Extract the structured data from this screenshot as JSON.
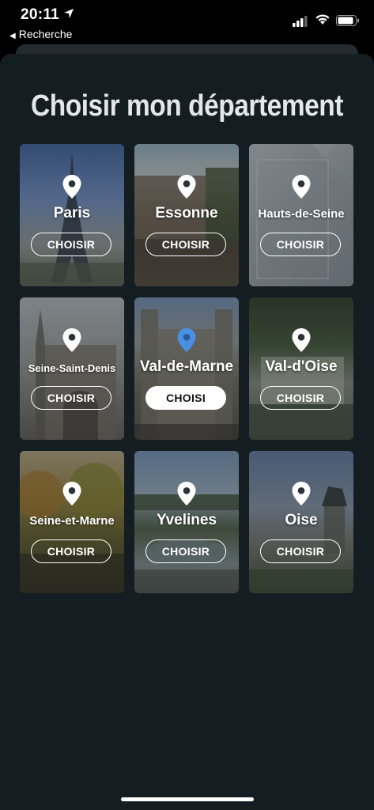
{
  "status": {
    "time": "20:11",
    "back_label": "Recherche"
  },
  "title": "Choisir mon département",
  "departments": [
    {
      "name": "Paris",
      "button": "CHOISIR",
      "selected": false
    },
    {
      "name": "Essonne",
      "button": "CHOISIR",
      "selected": false
    },
    {
      "name": "Hauts-de-Seine",
      "button": "CHOISIR",
      "selected": false
    },
    {
      "name": "Seine-Saint-Denis",
      "button": "CHOISIR",
      "selected": false
    },
    {
      "name": "Val-de-Marne",
      "button": "CHOISI",
      "selected": true
    },
    {
      "name": "Val-d'Oise",
      "button": "CHOISIR",
      "selected": false
    },
    {
      "name": "Seine-et-Marne",
      "button": "CHOISIR",
      "selected": false
    },
    {
      "name": "Yvelines",
      "button": "CHOISIR",
      "selected": false
    },
    {
      "name": "Oise",
      "button": "CHOISIR",
      "selected": false
    }
  ],
  "colors": {
    "background": "#141d22",
    "pin_default": "#ffffff",
    "pin_selected": "#4a90e2"
  }
}
